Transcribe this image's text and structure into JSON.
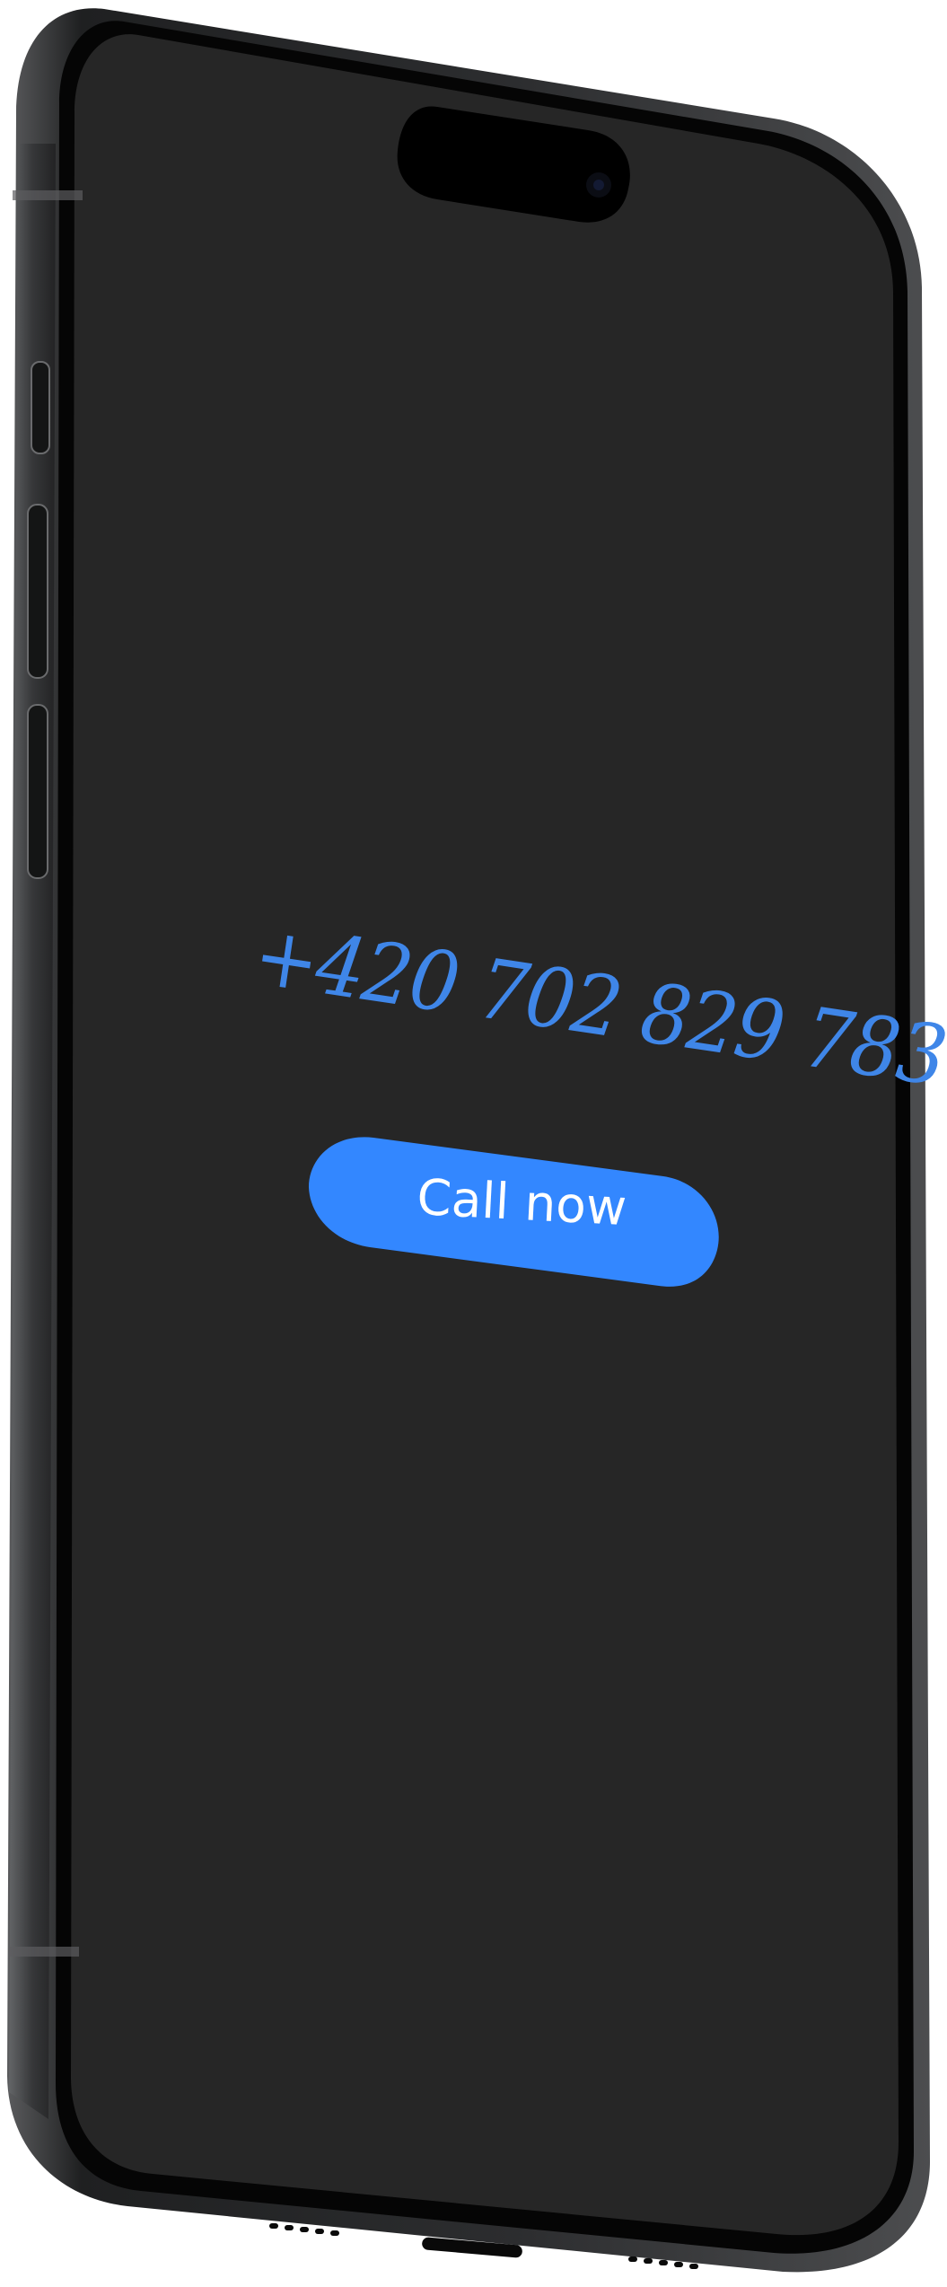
{
  "screen": {
    "phone_number": "+420 702 829 783",
    "call_button_label": "Call now"
  },
  "colors": {
    "screen_background": "#262626",
    "accent_blue": "#3387ff",
    "phone_number_text": "#3f86e8",
    "button_text": "#ffffff",
    "phone_frame": "#2f3031",
    "phone_bezel": "#050505"
  }
}
